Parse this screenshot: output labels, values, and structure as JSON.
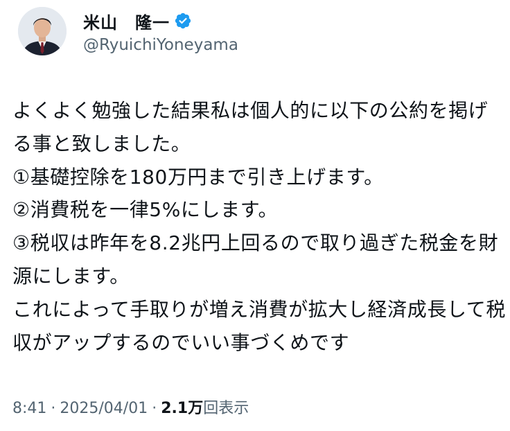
{
  "author": {
    "display_name": "米山　隆一",
    "handle": "@RyuichiYoneyama",
    "verified_icon": "verified-badge-icon",
    "verified_color": "#1d9bf0"
  },
  "tweet": {
    "text": "よくよく勉強した結果私は個人的に以下の公約を掲げる事と致しました。\n①基礎控除を180万円まで引き上げます。\n②消費税を一律5%にします。\n③税収は昨年を8.2兆円上回るので取り過ぎた税金を財源にします。\nこれによって手取りが増え消費が拡大し経済成長して税収がアップするのでいい事づくめです"
  },
  "meta": {
    "time": "8:41",
    "separator": "·",
    "date": "2025/04/01",
    "views_count": "2.1万",
    "views_label": "回表示"
  }
}
